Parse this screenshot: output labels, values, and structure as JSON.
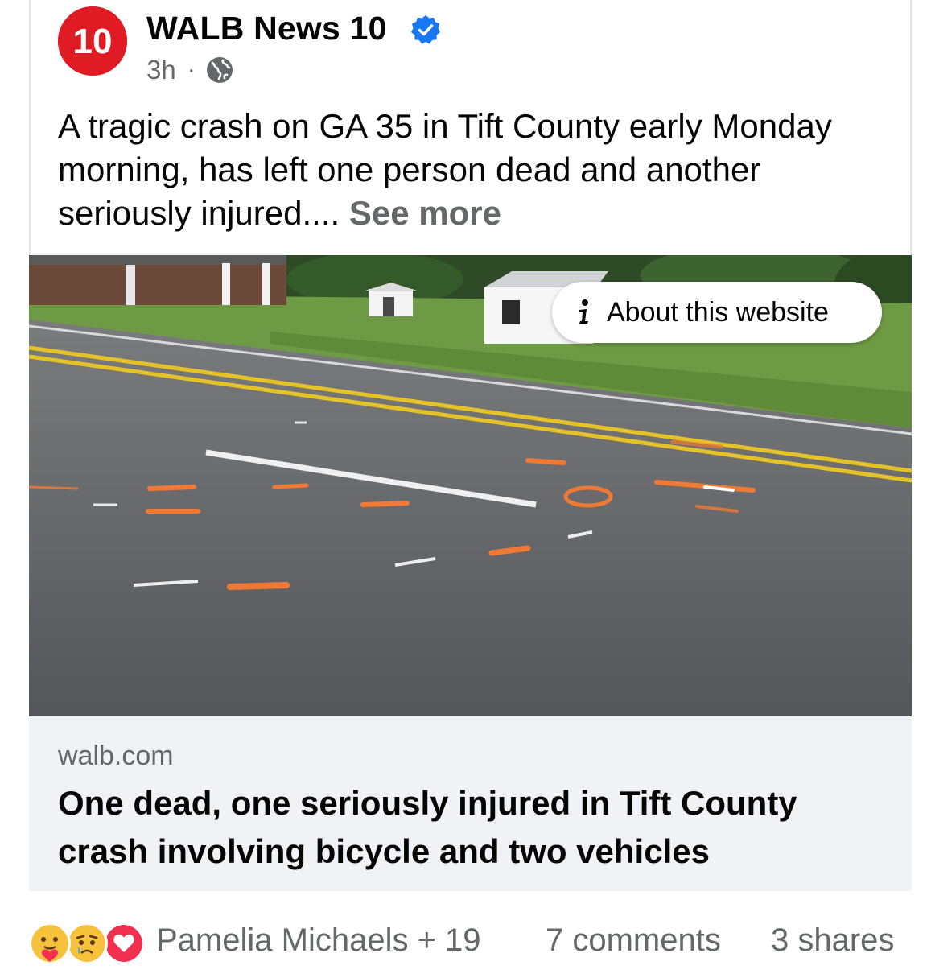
{
  "post": {
    "page_name": "WALB News 10",
    "avatar_text": "10",
    "timestamp": "3h",
    "separator": "·",
    "audience_icon": "globe-icon",
    "caption": "A tragic crash on GA 35 in Tift County early Monday morning, has left one person dead and another seriously injured....",
    "see_more": "See more"
  },
  "media": {
    "about_label": "About this website",
    "about_icon": "info-icon"
  },
  "link": {
    "domain": "walb.com",
    "headline": "One dead, one seriously injured in Tift County crash involving bicycle and two vehicles"
  },
  "engagement": {
    "reaction_icons": [
      "care-icon",
      "sad-icon",
      "love-icon"
    ],
    "reactors": "Pamelia Michaels + 19",
    "comments": "7 comments",
    "shares": "3 shares"
  },
  "colors": {
    "brand_red": "#e01b24",
    "verified_blue": "#1877f2",
    "secondary_text": "#65676b",
    "preview_bg": "#f0f2f5"
  }
}
